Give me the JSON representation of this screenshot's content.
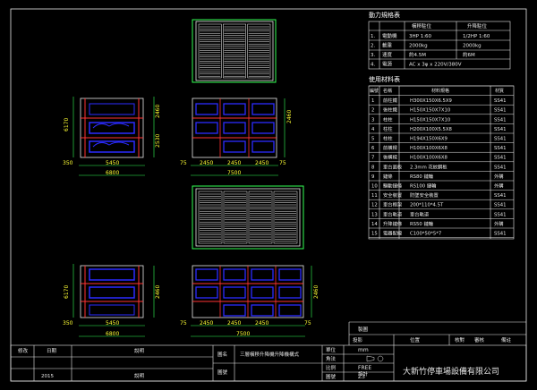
{
  "power_table": {
    "title": "動力規格表",
    "headers": [
      "",
      "",
      "橫移駐位",
      "升降駐位"
    ],
    "rows": [
      [
        "1.",
        "電動機",
        "3HP 1:60",
        "1/2HP 1:60"
      ],
      [
        "2.",
        "載重",
        "2000kg",
        "2000kg"
      ],
      [
        "3.",
        "速度",
        "約4.5M",
        "約6M"
      ],
      [
        "4.",
        "電源",
        "AC x 3φ x 220V/380V",
        ""
      ]
    ]
  },
  "material_table": {
    "title": "使用材料表",
    "headers": [
      "編號",
      "名稱",
      "材料規格",
      "材質"
    ],
    "rows": [
      [
        "1",
        "前柱鐵",
        "H300X150X6.5X9",
        "SS41"
      ],
      [
        "2",
        "後柱鐵",
        "H150X150X7X10",
        "SS41"
      ],
      [
        "3",
        "柱柱",
        "H150X150X7X10",
        "SS41"
      ],
      [
        "4",
        "柱柱",
        "H200X100X5.5X8",
        "SS41"
      ],
      [
        "5",
        "柱柱",
        "H194X150X6X9",
        "SS41"
      ],
      [
        "6",
        "前橫樑",
        "H100X100X6X8",
        "SS41"
      ],
      [
        "7",
        "後橫樑",
        "H100X100X6X8",
        "SS41"
      ],
      [
        "8",
        "車台面板",
        "2.3mm 花紋鋼板",
        "SS41"
      ],
      [
        "9",
        "鏈條",
        "RS80 鏈輪",
        "外購"
      ],
      [
        "10",
        "驅動鏈條",
        "RS100 鏈輪",
        "外購"
      ],
      [
        "11",
        "安全裝置",
        "防墜安全裝置",
        "SS41"
      ],
      [
        "12",
        "車台框架",
        "200*110*4.5T",
        "SS41"
      ],
      [
        "13",
        "車台軌道",
        "車台軌道",
        "SS41"
      ],
      [
        "14",
        "升降鏈條",
        "RS50 鏈輪",
        "外購"
      ],
      [
        "15",
        "電器配線",
        "C100*50*5*7",
        "SS41"
      ]
    ]
  },
  "dimensions": {
    "side_top": {
      "widths": [
        "350",
        "5450"
      ],
      "total": "6800",
      "heights": [
        "6170",
        "2460",
        "2530"
      ]
    },
    "front_top": {
      "widths": [
        "75",
        "2450",
        "2450",
        "2450",
        "75"
      ],
      "total": "7500",
      "height": "2460"
    },
    "side_bottom": {
      "widths": [
        "350",
        "5450"
      ],
      "total": "6800",
      "heights": [
        "6170",
        "2460"
      ]
    },
    "front_bottom": {
      "widths": [
        "75",
        "2450",
        "2450",
        "2450",
        "75"
      ],
      "total": "7500",
      "height": "2460"
    }
  },
  "title_block": {
    "revision": {
      "labels": [
        "修改",
        "日期",
        "說明"
      ],
      "row": [
        "",
        "2015",
        "說明"
      ]
    },
    "drawing_name_label": "圖名",
    "drawing_name": "三層橫移升降機升降機構式",
    "drawing_no_label": "圖號",
    "unit_label": "單位",
    "unit": "mm",
    "angle_label": "角法",
    "scale_label": "比例",
    "scale": "FREE",
    "sheet_label": "圖號",
    "sheet": "Z3",
    "header_cells": [
      "投影",
      "位置",
      "核對",
      "審核",
      "備註"
    ],
    "sub_cells": [
      "製圖",
      "設計"
    ],
    "company": "大新竹停車場設備有限公司"
  },
  "colors": {
    "background": "#000000",
    "frame": "#e8e8e8",
    "structure": "#ff3333",
    "platform": "#2b2bff",
    "dimension": "#33ff55",
    "grating": "#ffffff"
  }
}
